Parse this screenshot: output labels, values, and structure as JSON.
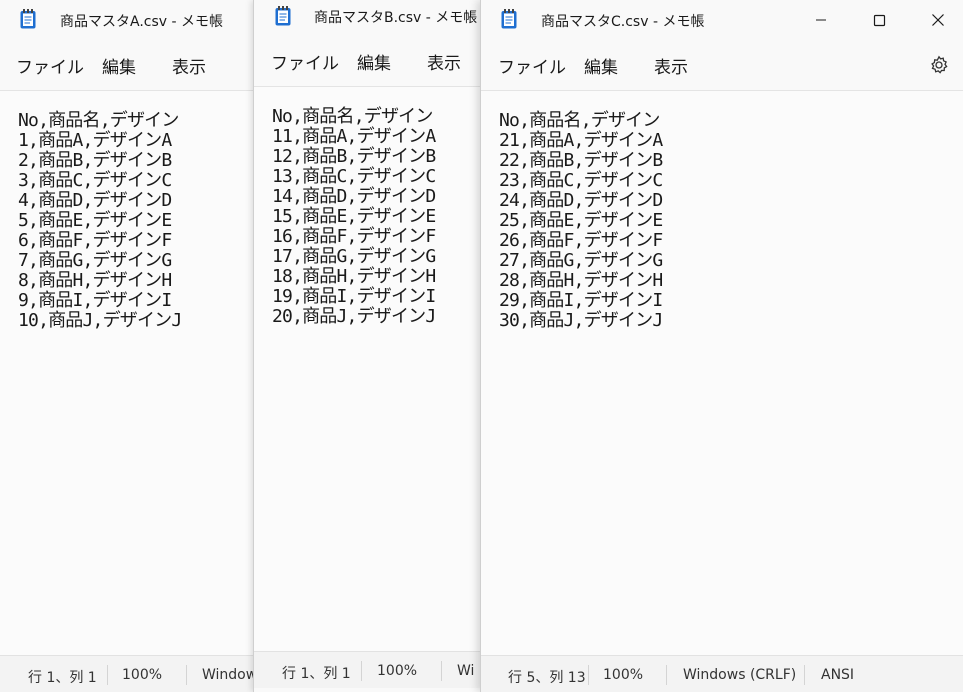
{
  "windows": {
    "a": {
      "title": "商品マスタA.csv - メモ帳",
      "menu": [
        "ファイル",
        "編集",
        "表示"
      ],
      "content": "No,商品名,デザイン\n1,商品A,デザインA\n2,商品B,デザインB\n3,商品C,デザインC\n4,商品D,デザインD\n5,商品E,デザインE\n6,商品F,デザインF\n7,商品G,デザインG\n8,商品H,デザインH\n9,商品I,デザインI\n10,商品J,デザインJ",
      "status": {
        "position": "行 1、列 1",
        "zoom": "100%",
        "line_ending": "Window"
      }
    },
    "b": {
      "title": "商品マスタB.csv - メモ帳",
      "menu": [
        "ファイル",
        "編集",
        "表示"
      ],
      "content": "No,商品名,デザイン\n11,商品A,デザインA\n12,商品B,デザインB\n13,商品C,デザインC\n14,商品D,デザインD\n15,商品E,デザインE\n16,商品F,デザインF\n17,商品G,デザインG\n18,商品H,デザインH\n19,商品I,デザインI\n20,商品J,デザインJ",
      "status": {
        "position": "行 1、列 1",
        "zoom": "100%",
        "line_ending": "Wi"
      }
    },
    "c": {
      "title": "商品マスタC.csv - メモ帳",
      "menu": [
        "ファイル",
        "編集",
        "表示"
      ],
      "content": "No,商品名,デザイン\n21,商品A,デザインA\n22,商品B,デザインB\n23,商品C,デザインC\n24,商品D,デザインD\n25,商品E,デザインE\n26,商品F,デザインF\n27,商品G,デザインG\n28,商品H,デザインH\n29,商品I,デザインI\n30,商品J,デザインJ",
      "status": {
        "position": "行 5、列 13",
        "zoom": "100%",
        "line_ending": "Windows (CRLF)",
        "encoding": "ANSI"
      }
    }
  },
  "icons": {
    "app": "notepad-icon",
    "minimize": "minimize-icon",
    "maximize": "maximize-icon",
    "close": "close-icon",
    "settings": "gear-icon"
  },
  "colors": {
    "window_bg": "#f9f9f9",
    "statusbar_bg": "#f3f3f3",
    "notepad_icon_blue": "#1f6fd1"
  }
}
